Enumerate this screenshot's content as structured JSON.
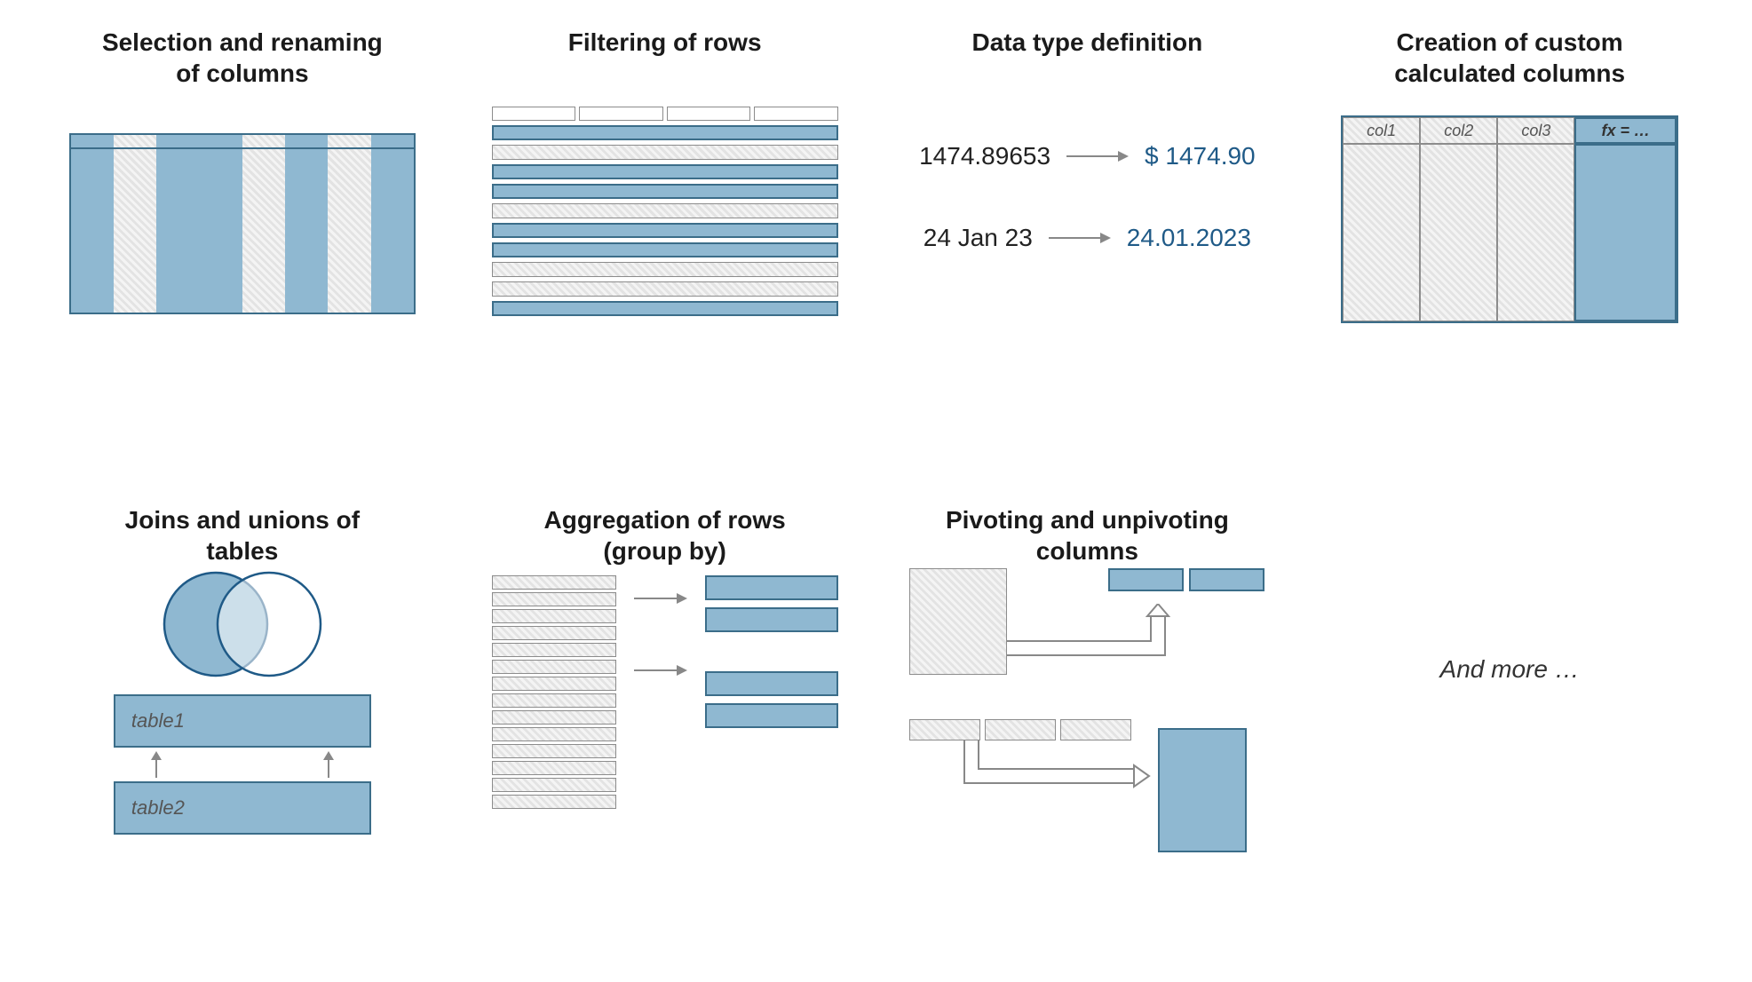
{
  "panels": {
    "selection": {
      "title": "Selection and renaming\nof columns"
    },
    "filtering": {
      "title": "Filtering of rows"
    },
    "datatype": {
      "title": "Data type definition",
      "row1_before": "1474.89653",
      "row1_after": "$ 1474.90",
      "row2_before": "24 Jan 23",
      "row2_after": "24.01.2023"
    },
    "calculated": {
      "title": "Creation of custom\ncalculated columns",
      "headers": [
        "col1",
        "col2",
        "col3"
      ],
      "fx_header": "fx  = …"
    },
    "joins": {
      "title": "Joins and unions of\ntables",
      "table1": "table1",
      "table2": "table2"
    },
    "aggregation": {
      "title": "Aggregation of rows\n(group by)"
    },
    "pivot": {
      "title": "Pivoting and unpivoting\ncolumns"
    },
    "more": {
      "text": "And more …"
    }
  }
}
